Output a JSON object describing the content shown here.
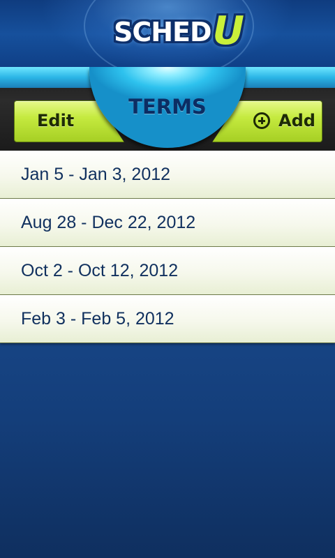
{
  "app": {
    "logo_main": "SCHED",
    "logo_accent": "U"
  },
  "header": {
    "title": "TERMS",
    "edit_label": "Edit",
    "add_label": "Add"
  },
  "terms": [
    {
      "label": "Jan 5 - Jan 3, 2012"
    },
    {
      "label": "Aug 28 - Dec 22, 2012"
    },
    {
      "label": "Oct 2 - Oct 12, 2012"
    },
    {
      "label": "Feb 3 - Feb 5, 2012"
    }
  ],
  "colors": {
    "background": "#1a4d92",
    "accent_green": "#c5ea3f",
    "header_cyan": "#2ec2ee",
    "text_dark_blue": "#10305e"
  }
}
